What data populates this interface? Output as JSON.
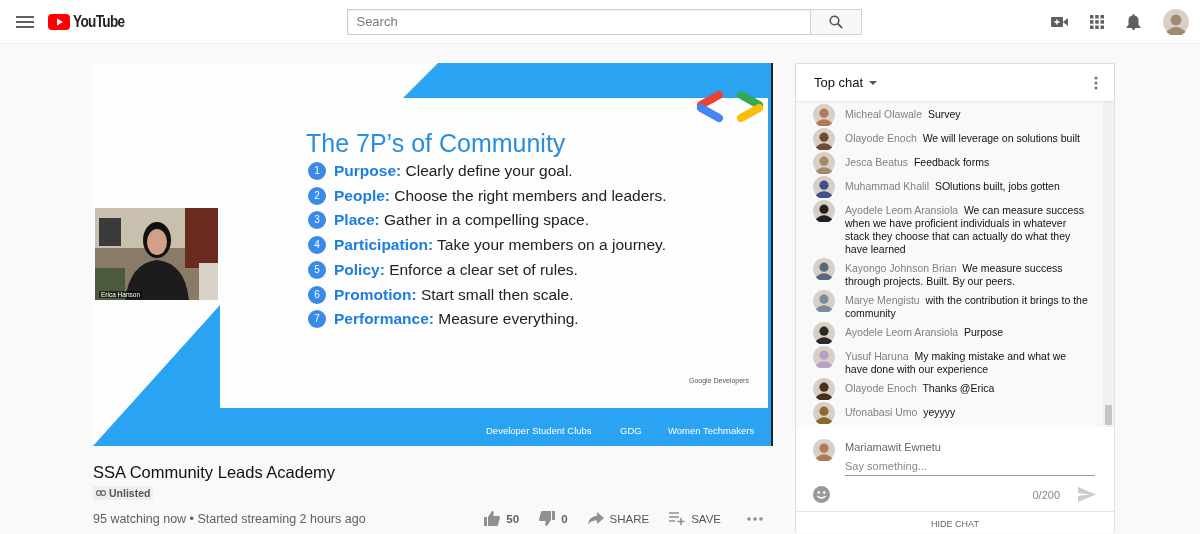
{
  "header": {
    "logo": "YouTube",
    "search": {
      "placeholder": "Search"
    }
  },
  "video": {
    "slide": {
      "title": "The 7P’s of Community",
      "points": [
        {
          "number": "1",
          "term": "Purpose:",
          "text": "Clearly define your goal."
        },
        {
          "number": "2",
          "term": "People:",
          "text": "Choose the right members and leaders."
        },
        {
          "number": "3",
          "term": "Place:",
          "text": "Gather in a compelling space."
        },
        {
          "number": "4",
          "term": "Participation:",
          "text": "Take your members on a journey."
        },
        {
          "number": "5",
          "term": "Policy:",
          "text": "Enforce a clear set of rules."
        },
        {
          "number": "6",
          "term": "Promotion:",
          "text": "Start small then scale."
        },
        {
          "number": "7",
          "term": "Performance:",
          "text": "Measure everything."
        }
      ],
      "brand": "Google Developers",
      "programs": [
        "Developer Student Clubs",
        "GDG",
        "Women Techmakers"
      ]
    },
    "camera": {
      "kind": "picture",
      "name": "Erica Hanson"
    }
  },
  "title": "SSA Community Leads Academy",
  "privacy": "Unlisted",
  "meta": "95 watching now • Started streaming 2 hours ago",
  "actions": [
    {
      "kind": "like",
      "label": "50"
    },
    {
      "kind": "dislike",
      "label": "0"
    },
    {
      "kind": "share",
      "label": "SHARE"
    },
    {
      "kind": "save",
      "label": "SAVE"
    },
    {
      "kind": "more"
    }
  ],
  "chat": {
    "mode": "Top chat",
    "messages": [
      {
        "author": "Micheal Olawale",
        "text": "Survey"
      },
      {
        "author": "Olayode Enoch",
        "text": "We will leverage on solutions built"
      },
      {
        "author": "Jesca Beatus",
        "text": "Feedback forms"
      },
      {
        "author": "Muhammad Khalil",
        "text": "SOlutions built, jobs gotten"
      },
      {
        "author": "Ayodele Leom Aransiola",
        "text": "We can measure success when we have proficient individuals in whatever stack they choose that can actually do what they have learned"
      },
      {
        "author": "Kayongo Johnson Brian",
        "text": "We measure success through projects. Built. By our peers."
      },
      {
        "author": "Marye Mengistu",
        "text": "with the contribution it brings to the community"
      },
      {
        "author": "Ayodele Leom Aransiola",
        "text": "Purpose"
      },
      {
        "author": "Yusuf Haruna",
        "text": "My making mistake and what we have done with our experience"
      },
      {
        "author": "Olayode Enoch",
        "text": "Thanks @Erica"
      },
      {
        "author": "Ufonabasi Umo",
        "text": "yeyyyy"
      }
    ],
    "composer": {
      "author": "Mariamawit Ewnetu",
      "placeholder": "Say something...",
      "counter": "0/200"
    },
    "hide": "HIDE CHAT"
  }
}
